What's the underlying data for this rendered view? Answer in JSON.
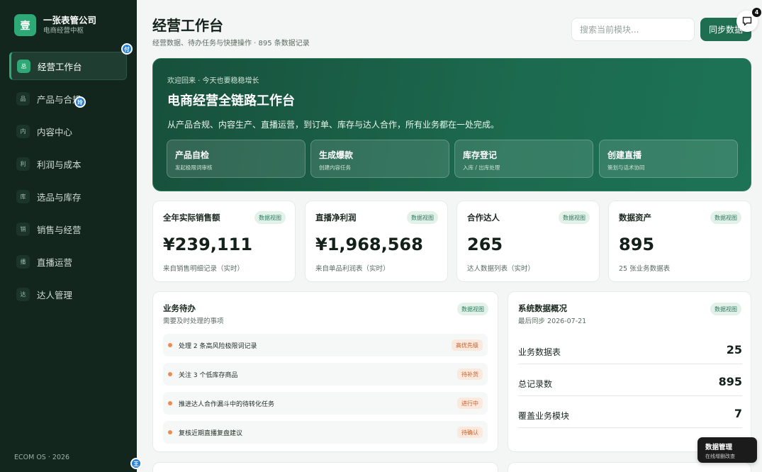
{
  "brand": {
    "logo_char": "壹",
    "name": "一张表管公司",
    "subtitle": "电商经营中枢"
  },
  "sidebar": {
    "items": [
      {
        "icon": "总",
        "label": "经营工作台",
        "active": true
      },
      {
        "icon": "品",
        "label": "产品与合规"
      },
      {
        "icon": "内",
        "label": "内容中心"
      },
      {
        "icon": "利",
        "label": "利润与成本"
      },
      {
        "icon": "库",
        "label": "选品与库存"
      },
      {
        "icon": "销",
        "label": "销售与经营"
      },
      {
        "icon": "播",
        "label": "直播运营"
      },
      {
        "icon": "达",
        "label": "达人管理"
      }
    ],
    "footer": "ECOM OS · 2026"
  },
  "pins": {
    "pay": "付",
    "compliance": "玲",
    "user": "王"
  },
  "header": {
    "title": "经营工作台",
    "subtitle": "经营数据、待办任务与快捷操作 · 895 条数据记录",
    "search_placeholder": "搜索当前模块...",
    "sync_label": "同步数据",
    "chat_badge": "4"
  },
  "hero": {
    "eyebrow": "欢迎回来 · 今天也要稳稳增长",
    "title": "电商经营全链路工作台",
    "description": "从产品合规、内容生产、直播运营，到订单、库存与达人合作，所有业务都在一处完成。",
    "actions": [
      {
        "title": "产品自检",
        "subtitle": "发起极限词审核"
      },
      {
        "title": "生成爆款",
        "subtitle": "创建内容任务"
      },
      {
        "title": "库存登记",
        "subtitle": "入库 / 出库处理"
      },
      {
        "title": "创建直播",
        "subtitle": "策划与话术协同"
      }
    ]
  },
  "stats": [
    {
      "label": "全年实际销售额",
      "tag": "数据视图",
      "value": "¥239,111",
      "note": "来自销售明细记录（实时）"
    },
    {
      "label": "直播净利润",
      "tag": "数据视图",
      "value": "¥1,968,568",
      "note": "来自单品利润表（实时）"
    },
    {
      "label": "合作达人",
      "tag": "数据视图",
      "value": "265",
      "note": "达人数据列表（实时）"
    },
    {
      "label": "数据资产",
      "tag": "数据视图",
      "value": "895",
      "note": "25 张业务数据表"
    }
  ],
  "todo_panel": {
    "title": "业务待办",
    "subtitle": "需要及时处理的事项",
    "tag": "数据视图",
    "items": [
      {
        "text": "处理 2 条高风险极限词记录",
        "status": "高优先级"
      },
      {
        "text": "关注 3 个低库存商品",
        "status": "待补货"
      },
      {
        "text": "推进达人合作漏斗中的待转化任务",
        "status": "进行中"
      },
      {
        "text": "复核近期直播复盘建议",
        "status": "待确认"
      }
    ]
  },
  "system_panel": {
    "title": "系统数据概况",
    "subtitle": "最后同步 2026-07-21",
    "tag": "数据视图",
    "rows": [
      {
        "label": "业务数据表",
        "value": "25"
      },
      {
        "label": "总记录数",
        "value": "895"
      },
      {
        "label": "覆盖业务模块",
        "value": "7"
      }
    ]
  },
  "float_card": {
    "title": "数据管理",
    "subtitle": "在线增删改查"
  }
}
